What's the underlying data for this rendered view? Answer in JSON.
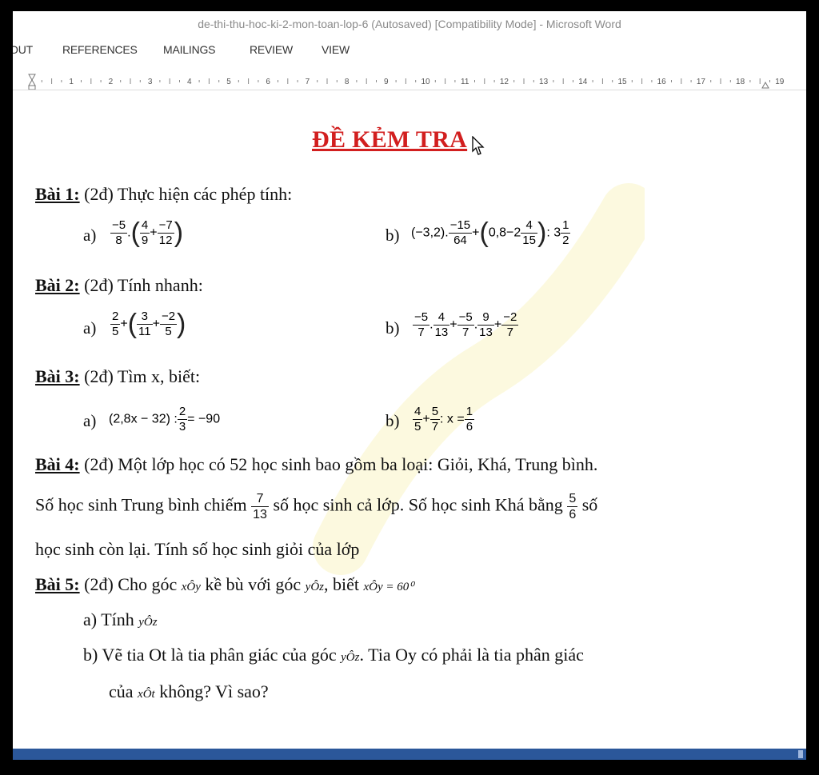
{
  "window": {
    "title": "de-thi-thu-hoc-ki-2-mon-toan-lop-6 (Autosaved) [Compatibility Mode] - Microsoft Word"
  },
  "ribbon": {
    "tabs": [
      "OUT",
      "REFERENCES",
      "MAILINGS",
      "REVIEW",
      "VIEW"
    ]
  },
  "ruler": {
    "numbers": [
      "1",
      "2",
      "3",
      "4",
      "5",
      "6",
      "7",
      "8",
      "9",
      "10",
      "11",
      "12",
      "13",
      "14",
      "15",
      "16",
      "17",
      "18",
      "19"
    ]
  },
  "doc": {
    "title": "ĐỀ KẺM TRA",
    "bai1": {
      "label": "Bài 1:",
      "text": " (2đ) Thực hiện các phép tính:"
    },
    "bai2": {
      "label": "Bài 2:",
      "text": " (2đ) Tính nhanh:"
    },
    "bai3": {
      "label": "Bài 3:",
      "text": " (2đ) Tìm x, biết:"
    },
    "bai4": {
      "label": "Bài 4:",
      "line1": " (2đ) Một lớp học có 52 học sinh bao gồm ba loại: Giỏi, Khá, Trung bình.",
      "line2a": "Số học sinh Trung bình chiếm ",
      "frac1_n": "7",
      "frac1_d": "13",
      "line2b": " số học sinh cả lớp. Số học sinh Khá bằng ",
      "frac2_n": "5",
      "frac2_d": "6",
      "line2c": " số",
      "line3": "học sinh còn lại. Tính số học sinh giỏi của lớp"
    },
    "bai5": {
      "label": "Bài 5:",
      "text1": " (2đ) Cho góc ",
      "angle1": "xÔy",
      "text2": " kề bù với góc ",
      "angle2": "yÔz",
      "text3": ", biết ",
      "given": "xÔy = 60⁰",
      "a_prefix": "a) Tính ",
      "a_angle": "yÔz",
      "b_prefix": "b) Vẽ tia Ot là tia phân giác của góc ",
      "b_angle": "yÔz",
      "b_rest": ". Tia Oy có phải là tia phân giác",
      "b2_prefix": "của ",
      "b2_angle": "xÔt",
      "b2_rest": " không? Vì sao?"
    },
    "labels": {
      "a": "a)",
      "b": "b)"
    },
    "math": {
      "b1a": {
        "f1n": "−5",
        "f1d": "8",
        "dot": ".",
        "f2n": "4",
        "f2d": "9",
        "plus": "+",
        "f3n": "−7",
        "f3d": "12"
      },
      "b1b": {
        "pre": "(−3,2).",
        "f1n": "−15",
        "f1d": "64",
        "plus": "+",
        "mid": "0,8−2",
        "f2n": "4",
        "f2d": "15",
        "post": ": 3",
        "f3n": "1",
        "f3d": "2"
      },
      "b2a": {
        "f1n": "2",
        "f1d": "5",
        "plus1": "+",
        "f2n": "3",
        "f2d": "11",
        "plus2": "+",
        "f3n": "−2",
        "f3d": "5"
      },
      "b2b": {
        "f1n": "−5",
        "f1d": "7",
        "dot1": ".",
        "f2n": "4",
        "f2d": "13",
        "plus1": "+",
        "f3n": "−5",
        "f3d": "7",
        "dot2": ".",
        "f4n": "9",
        "f4d": "13",
        "plus2": "+",
        "f5n": "−2",
        "f5d": "7"
      },
      "b3a": {
        "pre": "(2,8x − 32) :",
        "f1n": "2",
        "f1d": "3",
        "post": "= −90"
      },
      "b3b": {
        "f1n": "4",
        "f1d": "5",
        "plus": "+",
        "f2n": "5",
        "f2d": "7",
        "mid": ": x =",
        "f3n": "1",
        "f3d": "6"
      }
    }
  },
  "colors": {
    "title": "#d21f1f",
    "status": "#2b579a"
  }
}
